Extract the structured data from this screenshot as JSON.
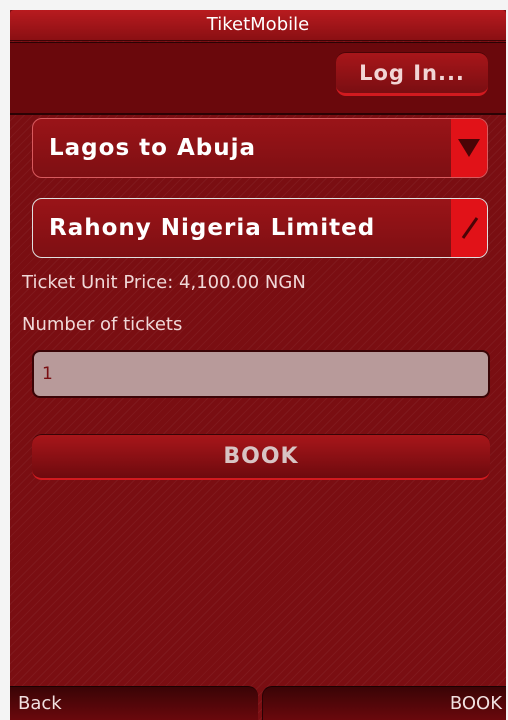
{
  "app": {
    "title": "TiketMobile"
  },
  "header": {
    "login_label": "Log In..."
  },
  "form": {
    "route": {
      "selected": "Lagos to Abuja"
    },
    "company": {
      "selected": "Rahony Nigeria Limited"
    },
    "price_text": "Ticket Unit Price: 4,100.00 NGN",
    "quantity_label": "Number of tickets",
    "quantity_value": "1",
    "book_label": "BOOK"
  },
  "softkeys": {
    "left": "Back",
    "right": "BOOK"
  },
  "colors": {
    "background": "#7a0e12",
    "accent": "#e11218",
    "input_bg": "#b89a9a"
  }
}
